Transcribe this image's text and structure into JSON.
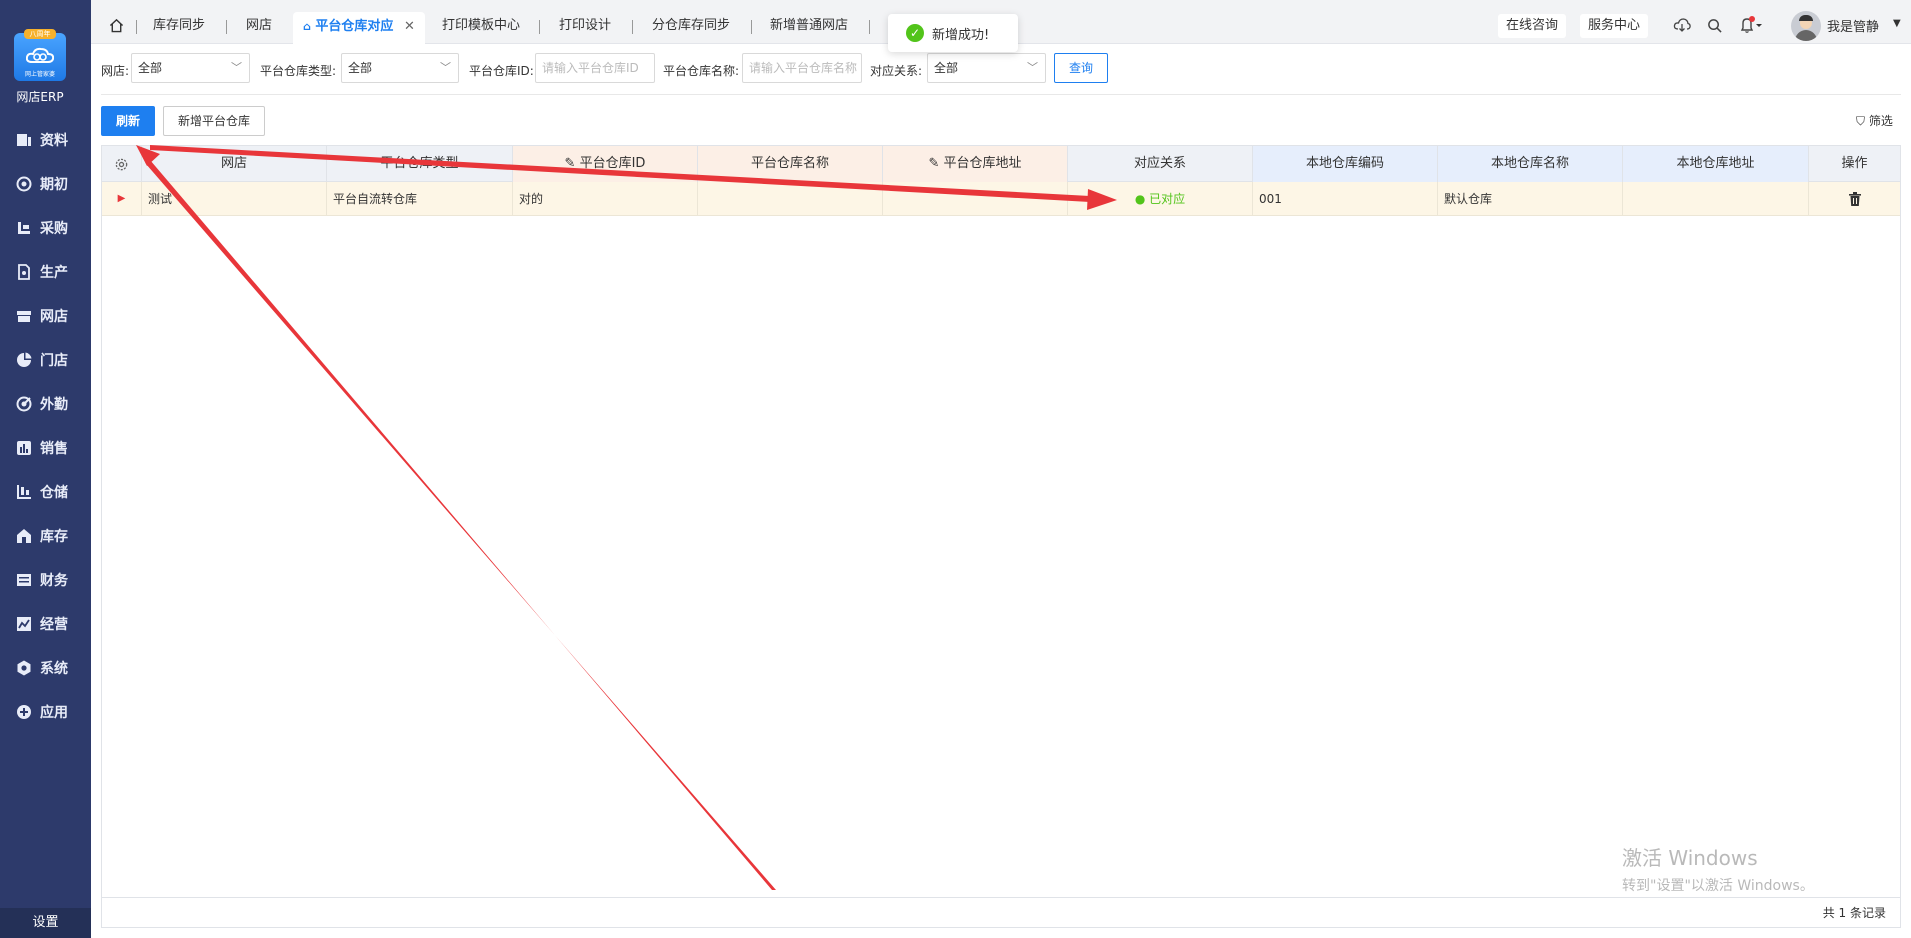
{
  "app": {
    "logo_badge": "八周年",
    "logo_sub": "网上管家婆",
    "name": "网店ERP"
  },
  "sidebar": {
    "items": [
      {
        "label": "资料",
        "icon": "data-icon"
      },
      {
        "label": "期初",
        "icon": "initial-icon"
      },
      {
        "label": "采购",
        "icon": "purchase-icon"
      },
      {
        "label": "生产",
        "icon": "production-icon"
      },
      {
        "label": "网店",
        "icon": "store-icon"
      },
      {
        "label": "门店",
        "icon": "pie-icon"
      },
      {
        "label": "外勤",
        "icon": "field-icon"
      },
      {
        "label": "销售",
        "icon": "sales-icon"
      },
      {
        "label": "仓储",
        "icon": "warehouse-icon"
      },
      {
        "label": "库存",
        "icon": "inventory-icon"
      },
      {
        "label": "财务",
        "icon": "finance-icon"
      },
      {
        "label": "经营",
        "icon": "operation-icon"
      },
      {
        "label": "系统",
        "icon": "system-icon"
      },
      {
        "label": "应用",
        "icon": "plus-icon"
      }
    ],
    "settings": "设置"
  },
  "tabs": [
    "库存同步",
    "网店",
    "平台仓库对应",
    "打印模板中心",
    "打印设计",
    "分仓库存同步",
    "新增普通网店"
  ],
  "topbar": {
    "consult": "在线咨询",
    "service": "服务中心",
    "username": "我是管静"
  },
  "toast": {
    "message": "新增成功!"
  },
  "filters": {
    "store_label": "网店:",
    "store_value": "全部",
    "type_label": "平台仓库类型:",
    "type_value": "全部",
    "id_label": "平台仓库ID:",
    "id_placeholder": "请输入平台仓库ID",
    "name_label": "平台仓库名称:",
    "name_placeholder": "请输入平台仓库名称",
    "relation_label": "对应关系:",
    "relation_value": "全部",
    "query": "查询"
  },
  "actions": {
    "refresh": "刷新",
    "add": "新增平台仓库",
    "filter": "筛选"
  },
  "table": {
    "columns": [
      "网店",
      "平台仓库类型",
      "平台仓库ID",
      "平台仓库名称",
      "平台仓库地址",
      "对应关系",
      "本地仓库编码",
      "本地仓库名称",
      "本地仓库地址",
      "操作"
    ],
    "rows": [
      {
        "store": "测试",
        "type": "平台自流转仓库",
        "id": "对的",
        "name": "",
        "address": "",
        "relation": "已对应",
        "local_code": "001",
        "local_name": "默认仓库",
        "local_address": ""
      }
    ],
    "footer": "共 1 条记录"
  },
  "watermark": {
    "title": "激活 Windows",
    "subtitle": "转到\"设置\"以激活 Windows。"
  },
  "colors": {
    "sidebar": "#2d3a6b",
    "accent": "#1e7ff0",
    "success": "#52c41a",
    "arrow": "#e8363a"
  }
}
